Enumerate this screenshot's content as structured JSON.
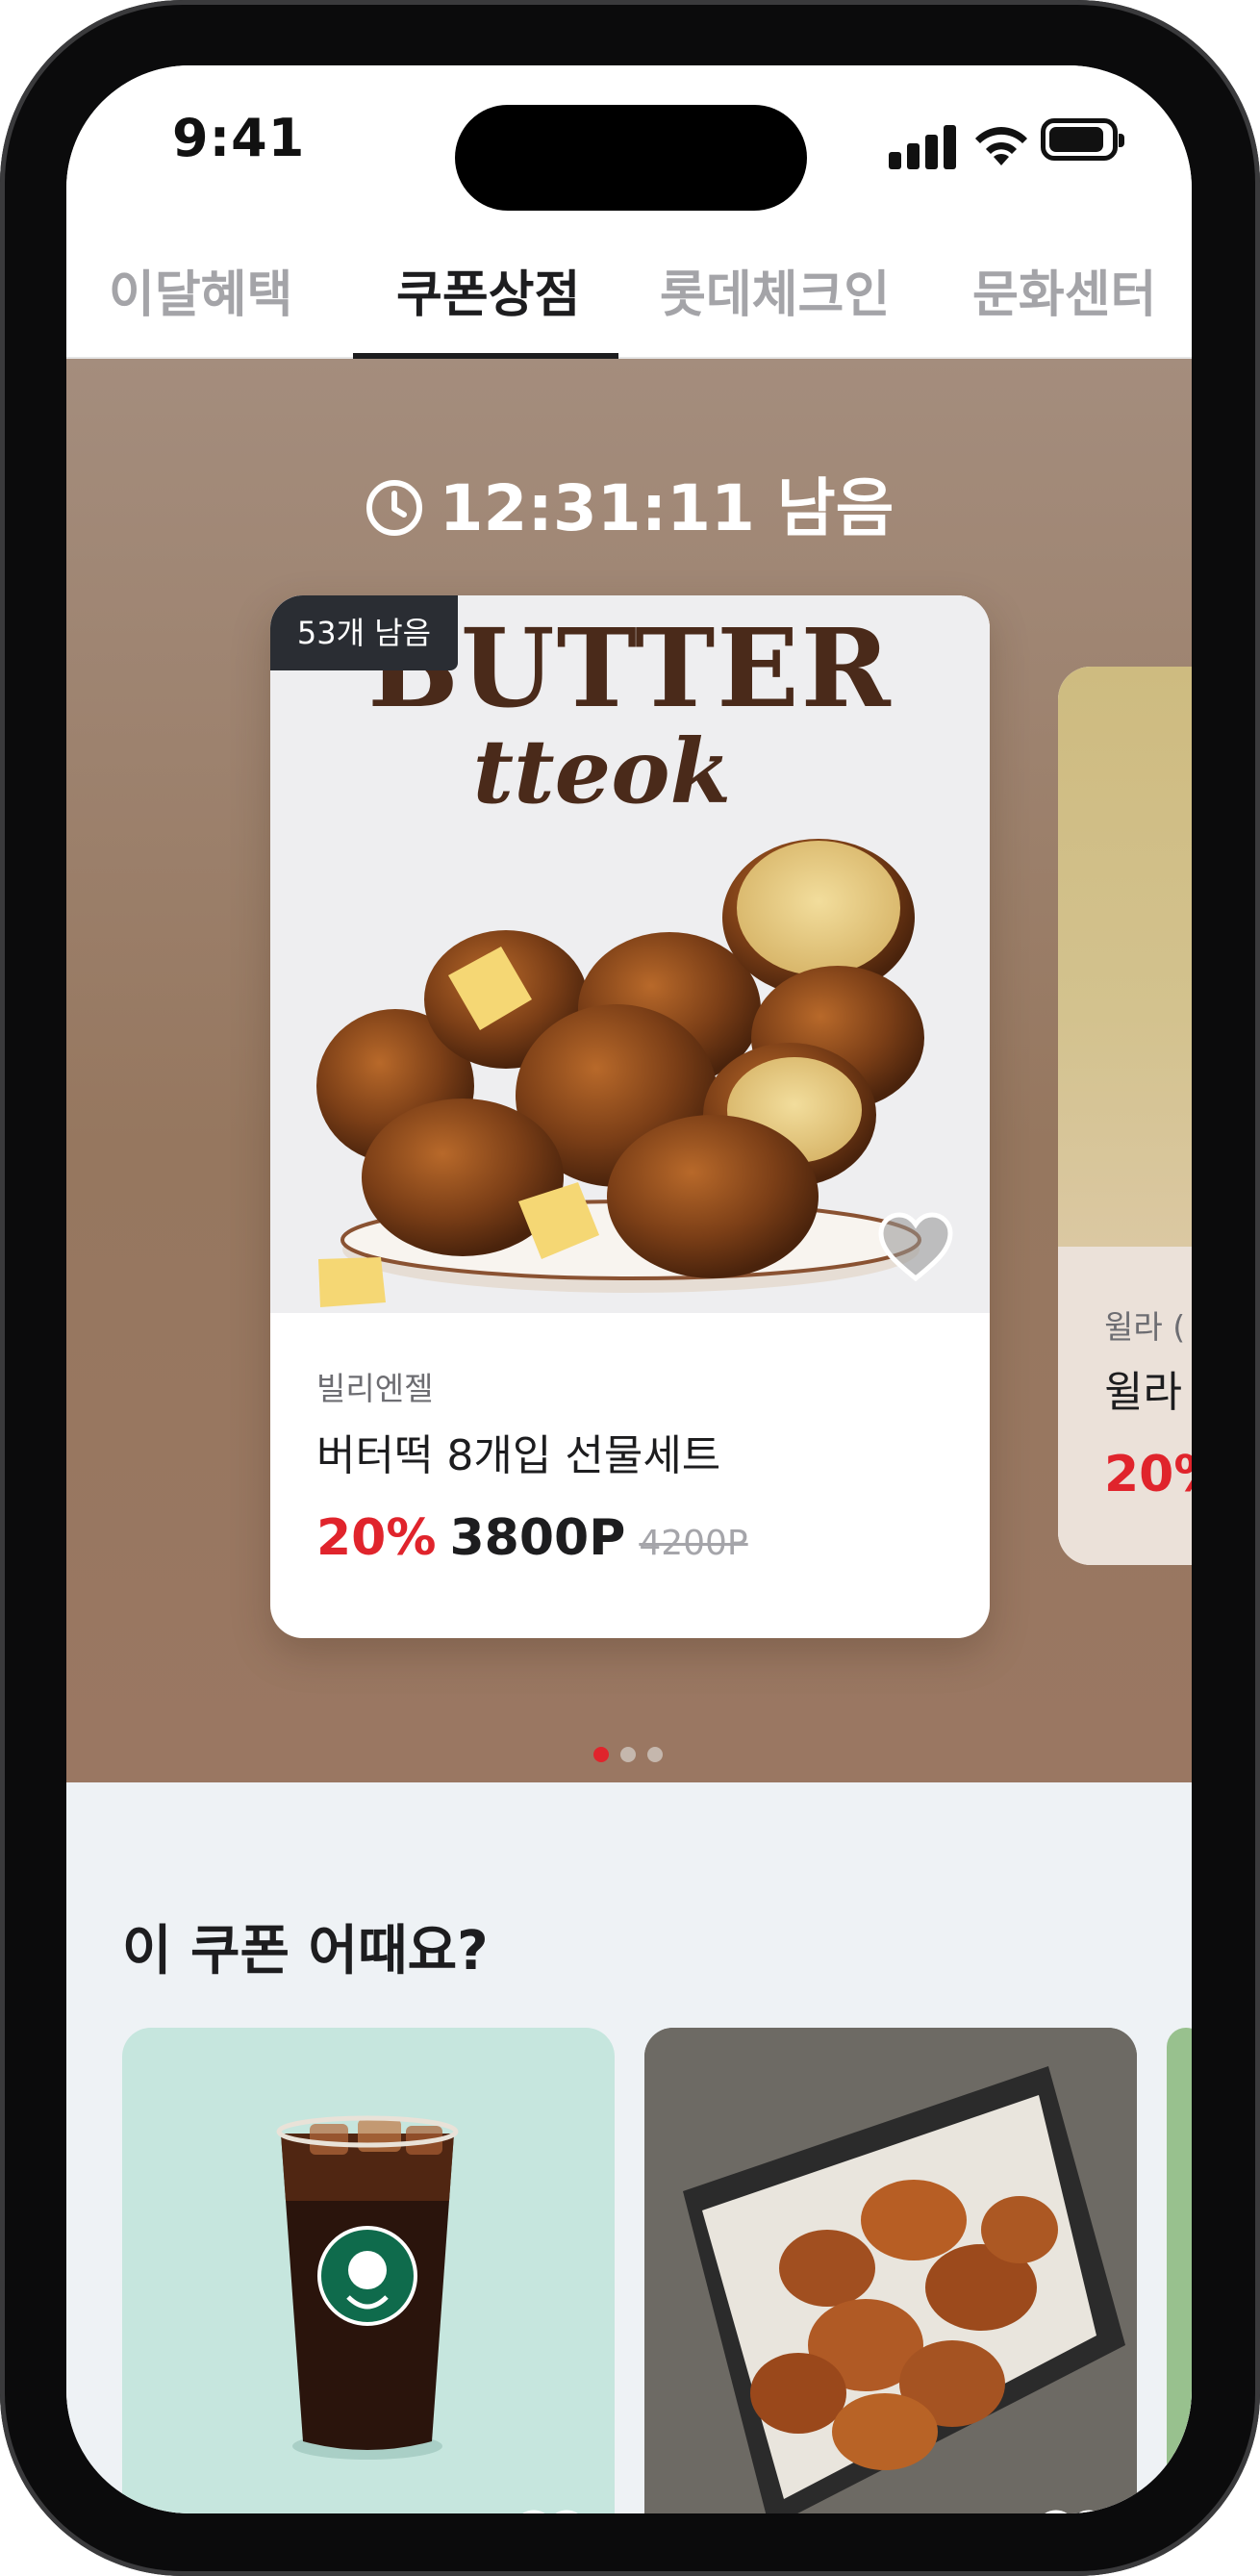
{
  "status_bar": {
    "time": "9:41"
  },
  "tabs": [
    {
      "label": "이달혜택",
      "active": false
    },
    {
      "label": "쿠폰상점",
      "active": true
    },
    {
      "label": "롯데체크인",
      "active": false
    },
    {
      "label": "문화센터",
      "active": false
    }
  ],
  "hero": {
    "timer": "12:31:11 남음",
    "background_color": "#9a7862",
    "featured": {
      "badge": "53개 남음",
      "image_text_main": "BUTTER",
      "image_text_script": "tteok",
      "brand": "빌리엔젤",
      "name": "버터떡 8개입 선물세트",
      "discount": "20%",
      "price": "3800P",
      "original_price": "4200P"
    },
    "next_card": {
      "brand": "윌라 (",
      "name": "윌라",
      "discount": "20%"
    },
    "pagination": {
      "count": 3,
      "active_index": 0
    }
  },
  "recommend": {
    "title": "이 쿠폰 어때요?",
    "items": [
      {
        "image": "iced-americano-starbucks",
        "bg": "#c6e6de"
      },
      {
        "image": "fried-chicken-basket",
        "bg": "#6f6c67"
      },
      {
        "image": "partial-green-card",
        "bg": "#98c18e"
      }
    ]
  },
  "colors": {
    "accent": "#e0242c",
    "text_primary": "#1d1d1f",
    "text_muted": "#a4a4a8"
  }
}
